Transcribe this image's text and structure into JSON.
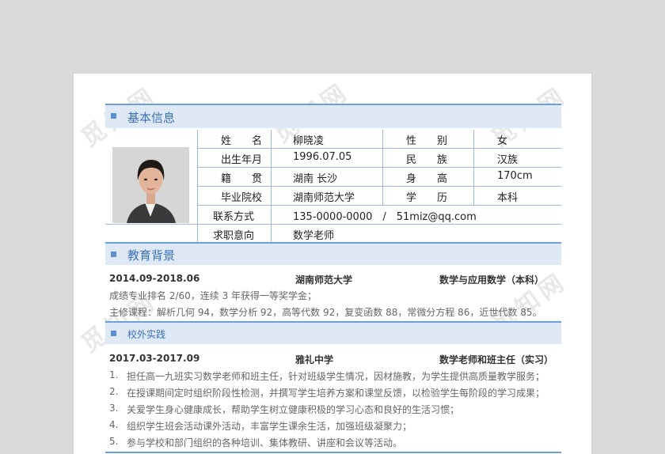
{
  "watermark": {
    "text": "觅知网"
  },
  "basic": {
    "title": "基本信息",
    "rows": [
      {
        "l1": "姓　　名",
        "v1": "柳晓凌",
        "l2": "性　　别",
        "v2": "女"
      },
      {
        "l1": "出生年月",
        "v1": "1996.07.05",
        "l2": "民　　族",
        "v2": "汉族"
      },
      {
        "l1": "籍　　贯",
        "v1": "湖南  长沙",
        "l2": "身　　高",
        "v2": "170cm"
      },
      {
        "l1": "毕业院校",
        "v1": "湖南师范大学",
        "l2": "学　　历",
        "v2": "本科"
      }
    ],
    "contact_label": "联系方式",
    "contact_value": "135-0000-0000　/　51miz@qq.com",
    "intent_label": "求职意向",
    "intent_value": "数学老师"
  },
  "education": {
    "title": "教育背景",
    "date": "2014.09-2018.06",
    "school": "湖南师范大学",
    "major": "数学与应用数学（本科）",
    "line1": "成绩专业排名 2/60，连续 3 年获得一等奖学金；",
    "line2": "主修课程：解析几何 94，数学分析 92，高等代数 92，复变函数 88，常微分方程 86，近世代数 85。"
  },
  "practice": {
    "title": "校外实践",
    "date": "2017.03-2017.09",
    "org": "雅礼中学",
    "role": "数学老师和班主任（实习）",
    "items": [
      {
        "num": "1.",
        "text": "担任高一九班实习数学老师和班主任，针对班级学生情况，因材施教，为学生提供高质量教学服务；"
      },
      {
        "num": "2.",
        "text": "在授课期间定时组织阶段性检测，并撰写学生培养方案和课堂反馈，以检验学生每阶段的学习成果；"
      },
      {
        "num": "3.",
        "text": "关爱学生身心健康成长，帮助学生树立健康积极的学习心态和良好的生活习惯；"
      },
      {
        "num": "4.",
        "text": "组织学生班会活动课外活动，丰富学生课余生活，加强班级凝聚力；"
      },
      {
        "num": "5.",
        "text": "参与学校和部门组织的各种培训、集体教研、讲座和会议等活动。"
      }
    ]
  }
}
